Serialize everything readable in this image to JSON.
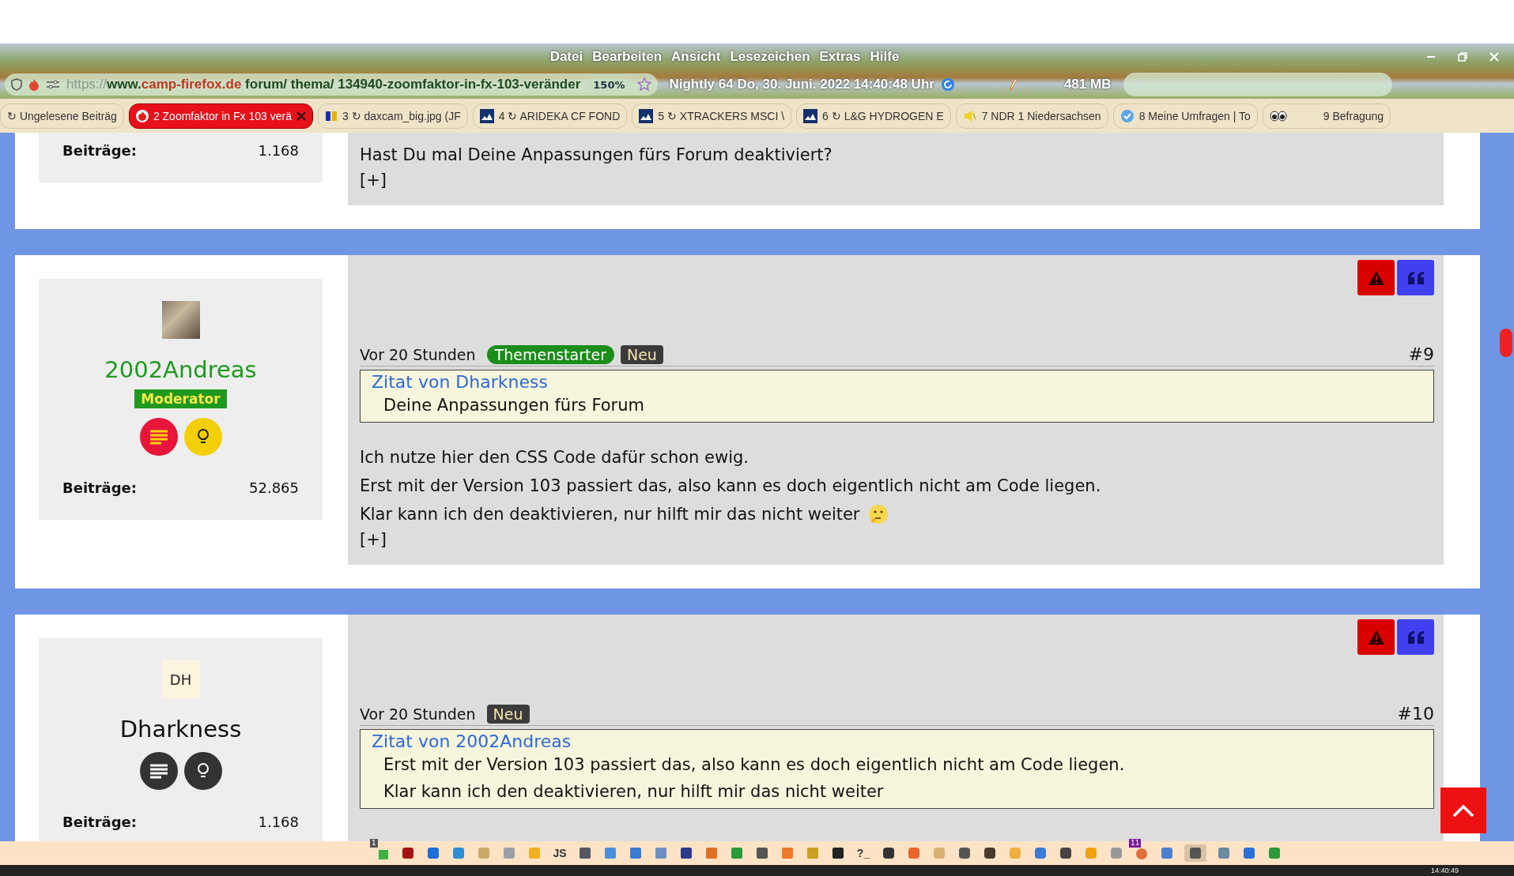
{
  "menu": [
    "Datei",
    "Bearbeiten",
    "Ansicht",
    "Lesezeichen",
    "Extras",
    "Hilfe"
  ],
  "urlbar": {
    "scheme": "https://",
    "host_prefix": "www.",
    "domain": "camp-firefox.de",
    "path": " forum/ thema/ 134940-zoomfaktor-in-fx-103-veränder",
    "zoom": "150%",
    "status": "Nightly 64 Do, 30. Juni. 2022 14:40:48 Uhr",
    "memory": "481 MB"
  },
  "tabs": [
    {
      "label": "↻ Ungelesene Beiträg",
      "selected": false,
      "kind": "plain"
    },
    {
      "label": "2 Zoomfaktor in Fx 103 verä",
      "selected": true,
      "kind": "fire"
    },
    {
      "label": "3 ↻ daxcam_big.jpg (JF",
      "selected": false,
      "kind": "letters"
    },
    {
      "label": "4 ↻ ARIDEKA CF FOND",
      "selected": false,
      "kind": "chart"
    },
    {
      "label": "5 ↻ XTRACKERS MSCI \\",
      "selected": false,
      "kind": "chart"
    },
    {
      "label": "6 ↻ L&G HYDROGEN E",
      "selected": false,
      "kind": "chart"
    },
    {
      "label": "7 NDR 1 Niedersachsen",
      "selected": false,
      "kind": "speaker"
    },
    {
      "label": "8 Meine Umfragen | To",
      "selected": false,
      "kind": "bubble"
    },
    {
      "label": "9 Befragung",
      "selected": false,
      "kind": "eyes"
    }
  ],
  "posts": [
    {
      "posts_label": "Beiträge:",
      "posts_count": "1.168",
      "lines": [
        "Hast Du mal Deine Anpassungen fürs Forum deaktiviert?"
      ],
      "expand": "[+]"
    },
    {
      "avatar": {
        "kind": "photo"
      },
      "username": "2002Andreas",
      "color": "#1e9a1e",
      "role": "Moderator",
      "badges": [
        {
          "kind": "list",
          "color": "#e8163a"
        },
        {
          "kind": "bulb",
          "color": "#f3cf0a"
        }
      ],
      "posts_label": "Beiträge:",
      "posts_count": "52.865",
      "time": "Vor 20 Stunden",
      "tags": [
        {
          "label": "Themenstarter",
          "kind": "starter"
        },
        {
          "label": "Neu",
          "kind": "new"
        }
      ],
      "number": "#9",
      "quote": {
        "title": "Zitat von Dharkness",
        "lines": [
          "Deine Anpassungen fürs Forum"
        ]
      },
      "lines": [
        "Ich nutze hier den CSS Code dafür schon ewig.",
        "Erst mit der Version 103 passiert das, also kann es doch eigentlich nicht am Code liegen.",
        "Klar kann ich den deaktivieren, nur hilft mir das nicht weiter"
      ],
      "emoji": true,
      "expand": "[+]"
    },
    {
      "avatar": {
        "kind": "initials",
        "text": "DH"
      },
      "username": "Dharkness",
      "color": "#111111",
      "badges": [
        {
          "kind": "list",
          "color": "#333333"
        },
        {
          "kind": "bulb",
          "color": "#333333"
        }
      ],
      "posts_label": "Beiträge:",
      "posts_count": "1.168",
      "time": "Vor 20 Stunden",
      "tags": [
        {
          "label": "Neu",
          "kind": "new"
        }
      ],
      "number": "#10",
      "quote": {
        "title": "Zitat von 2002Andreas",
        "lines": [
          "Erst mit der Version 103 passiert das, also kann es doch eigentlich nicht am Code liegen.",
          "Klar kann ich den deaktivieren, nur hilft mir das nicht weiter"
        ]
      }
    }
  ],
  "addon_bar": {
    "badges": [
      "1",
      "11"
    ],
    "labels": [
      "JS",
      "?_"
    ]
  },
  "taskbar": {
    "clock": "14:40:49"
  }
}
